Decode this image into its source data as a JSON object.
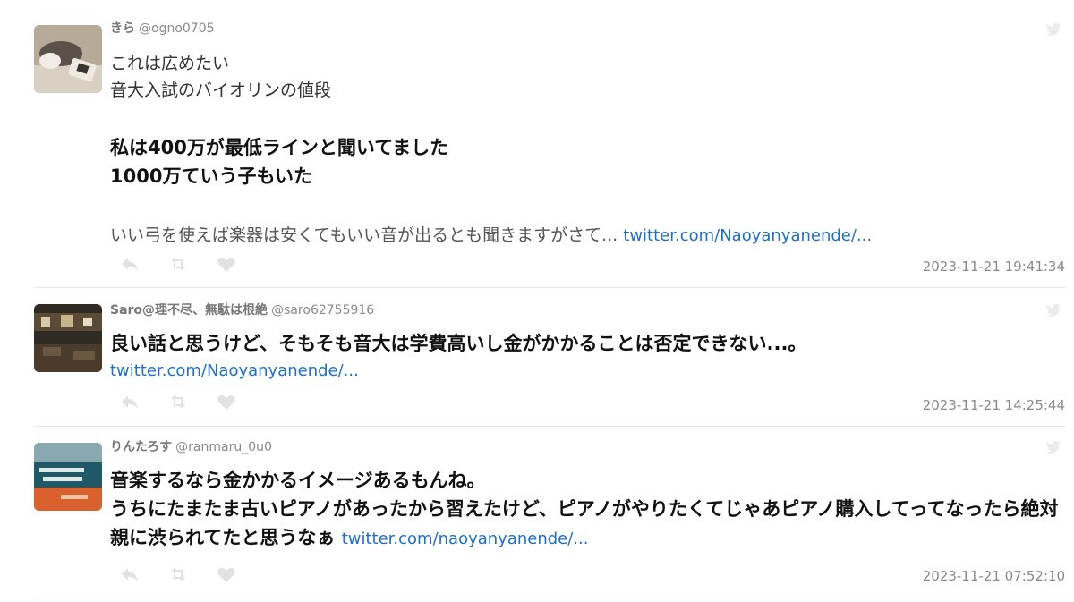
{
  "tweets": [
    {
      "user_name": "きら",
      "handle": "@ogno0705",
      "text_lines": [
        "これは広めたい",
        "音大入試のバイオリンの値段"
      ],
      "bold_lines": [
        "私は400万が最低ラインと聞いてました",
        "1000万ていう子もいた"
      ],
      "trailing_text": "いい弓を使えば楽器は安くてもいい音が出るとも聞きますがさて... ",
      "link": "twitter.com/Naoyanyanende/...",
      "timestamp": "2023-11-21 19:41:34"
    },
    {
      "user_name": "Saro@理不尽、無駄は根絶",
      "handle": "@saro62755916",
      "bold_text": "良い話と思うけど、そもそも音大は学費高いし金がかかることは否定できない...。",
      "link": "twitter.com/Naoyanyanende/...",
      "timestamp": "2023-11-21 14:25:44"
    },
    {
      "user_name": "りんたろす",
      "handle": "@ranmaru_0u0",
      "bold_text": "音楽するなら金かかるイメージあるもんね。\nうちにたまたま古いピアノがあったから習えたけど、ピアノがやりたくてじゃあピアノ購入してってなったら絶対親に渋られてたと思うなぁ ",
      "link": "twitter.com/naoyanyanende/...",
      "timestamp": "2023-11-21 07:52:10"
    }
  ],
  "icons": {
    "reply": "reply-icon",
    "retweet": "retweet-icon",
    "like": "heart-icon",
    "service": "twitter-bird-icon"
  },
  "colors": {
    "link": "#1f6fc5",
    "icon": "#e2e2e2",
    "meta": "#8a8a8a"
  }
}
